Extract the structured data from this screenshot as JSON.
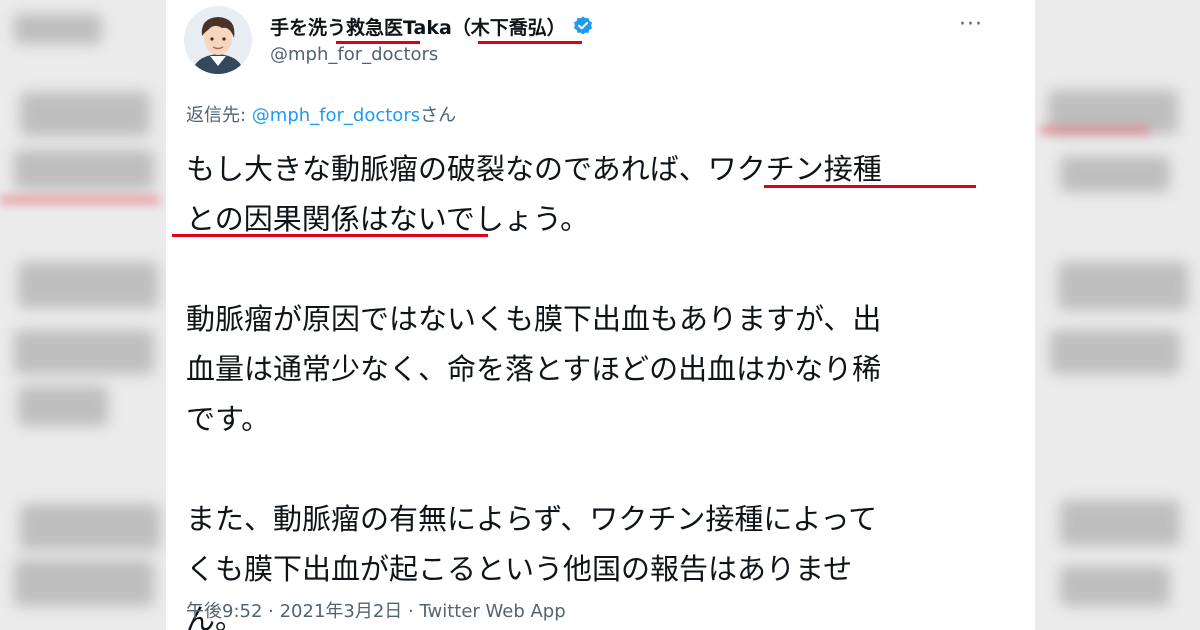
{
  "tweet": {
    "display_name": "手を洗う救急医Taka（木下喬弘）",
    "handle": "@mph_for_doctors",
    "more_icon": "more-horizontal-icon",
    "verified_icon": "verified-badge-icon",
    "reply_prefix": "返信先: ",
    "reply_mention": "@mph_for_doctors",
    "reply_suffix": "さん",
    "body_lines": [
      "もし大きな動脈瘤の破裂なのであれば、ワクチン接種",
      "との因果関係はないでしょう。",
      "動脈瘤が原因ではないくも膜下出血もありますが、出",
      "血量は通常少なく、命を落とすほどの出血はかなり稀",
      "です。",
      "また、動脈瘤の有無によらず、ワクチン接種によって",
      "くも膜下出血が起こるという他国の報告はありませ",
      "ん。"
    ],
    "timestamp": "午後9:52 · 2021年3月2日 · Twitter Web App"
  },
  "colors": {
    "highlight_underline": "#e0001a",
    "verified": "#1d9bf0",
    "link": "#1d9bf0",
    "secondary_text": "#536471"
  }
}
